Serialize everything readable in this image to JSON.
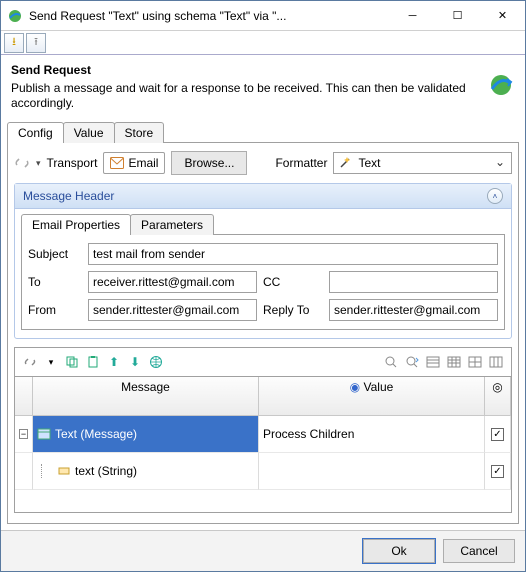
{
  "window": {
    "title": "Send Request \"Text\" using schema \"Text\" via \"..."
  },
  "heading": {
    "title": "Send Request",
    "description": "Publish a message and wait for a response to be received.  This can then be validated accordingly."
  },
  "tabs": {
    "config": "Config",
    "value": "Value",
    "store": "Store"
  },
  "transport": {
    "label": "Transport",
    "method": "Email",
    "browse": "Browse...",
    "formatter_label": "Formatter",
    "formatter_value": "Text"
  },
  "message_header": {
    "title": "Message Header",
    "inner_tabs": {
      "email_props": "Email Properties",
      "parameters": "Parameters"
    },
    "fields": {
      "subject_label": "Subject",
      "subject_value": "test mail from sender",
      "to_label": "To",
      "to_value": "receiver.rittest@gmail.com",
      "cc_label": "CC",
      "cc_value": "",
      "from_label": "From",
      "from_value": "sender.rittester@gmail.com",
      "replyto_label": "Reply To",
      "replyto_value": "sender.rittester@gmail.com"
    }
  },
  "tree": {
    "col_message": "Message",
    "col_value": "Value",
    "rows": [
      {
        "label": "Text (Message)",
        "value": "Process Children",
        "checked": true,
        "selected": true
      },
      {
        "label": "text (String)",
        "value": "",
        "checked": true,
        "selected": false
      }
    ]
  },
  "footer": {
    "ok": "Ok",
    "cancel": "Cancel"
  }
}
